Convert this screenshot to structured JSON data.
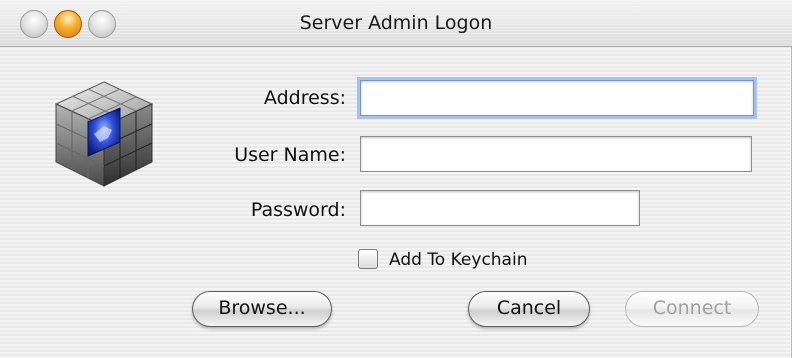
{
  "window": {
    "title": "Server Admin Logon",
    "controls": [
      "close",
      "minimize",
      "zoom"
    ]
  },
  "app_icon": "server-admin-cube-icon",
  "form": {
    "address_label": "Address:",
    "address_value": "",
    "username_label": "User Name:",
    "username_value": "",
    "password_label": "Password:",
    "password_value": "",
    "keychain_label": "Add To Keychain",
    "keychain_checked": false
  },
  "buttons": {
    "browse": "Browse...",
    "cancel": "Cancel",
    "connect": "Connect"
  },
  "colors": {
    "focus_ring": "#a7c3e9",
    "minimize_button": "#f5b234"
  }
}
